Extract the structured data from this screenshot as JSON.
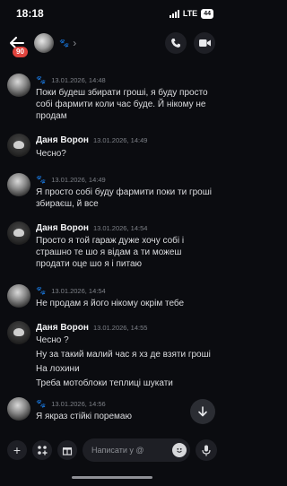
{
  "status_bar": {
    "time": "18:18",
    "network": "LTE",
    "battery": "44"
  },
  "header": {
    "unread_badge": "90",
    "title": "🐾",
    "chevron": "›"
  },
  "messages": [
    {
      "author": "🐾",
      "author_is_emoji": true,
      "timestamp": "13.01.2026, 14:48",
      "lines": [
        "Поки будеш збирати гроші, я буду просто собі фармити коли час буде. Й нікому не продам"
      ],
      "avatar": "grey"
    },
    {
      "author": "Даня Ворон",
      "timestamp": "13.01.2026, 14:49",
      "lines": [
        "Чесно?"
      ],
      "avatar": "crow"
    },
    {
      "author": "🐾",
      "author_is_emoji": true,
      "timestamp": "13.01.2026, 14:49",
      "lines": [
        "Я просто собі буду фармити поки ти гроші збираєш, й все"
      ],
      "avatar": "grey"
    },
    {
      "author": "Даня Ворон",
      "timestamp": "13.01.2026, 14:54",
      "lines": [
        "Просто я той гараж дуже хочу собі і страшно те шо я відам а ти можеш продати оце шо я і питаю"
      ],
      "avatar": "crow"
    },
    {
      "author": "🐾",
      "author_is_emoji": true,
      "timestamp": "13.01.2026, 14:54",
      "lines": [
        "Не продам я його нікому окрім тебе"
      ],
      "avatar": "grey"
    },
    {
      "author": "Даня Ворон",
      "timestamp": "13.01.2026, 14:55",
      "lines": [
        "Чесно ?",
        "Ну за такий малий час я хз де взяти гроші",
        "На лохини",
        "Треба мотоблоки теплиці шукати"
      ],
      "avatar": "crow"
    },
    {
      "author": "🐾",
      "author_is_emoji": true,
      "timestamp": "13.01.2026, 14:56",
      "lines": [
        "Я якраз стійкі поремаю"
      ],
      "avatar": "grey"
    }
  ],
  "composer": {
    "placeholder": "Написати у @",
    "add_icon": "+"
  },
  "icons": {
    "back": "arrow-left-icon",
    "call": "phone-icon",
    "video": "video-camera-icon",
    "scroll": "arrow-down-icon",
    "emoji": "emoji-icon",
    "mic": "microphone-icon",
    "gift": "gift-icon",
    "apps": "grid-apps-icon"
  }
}
